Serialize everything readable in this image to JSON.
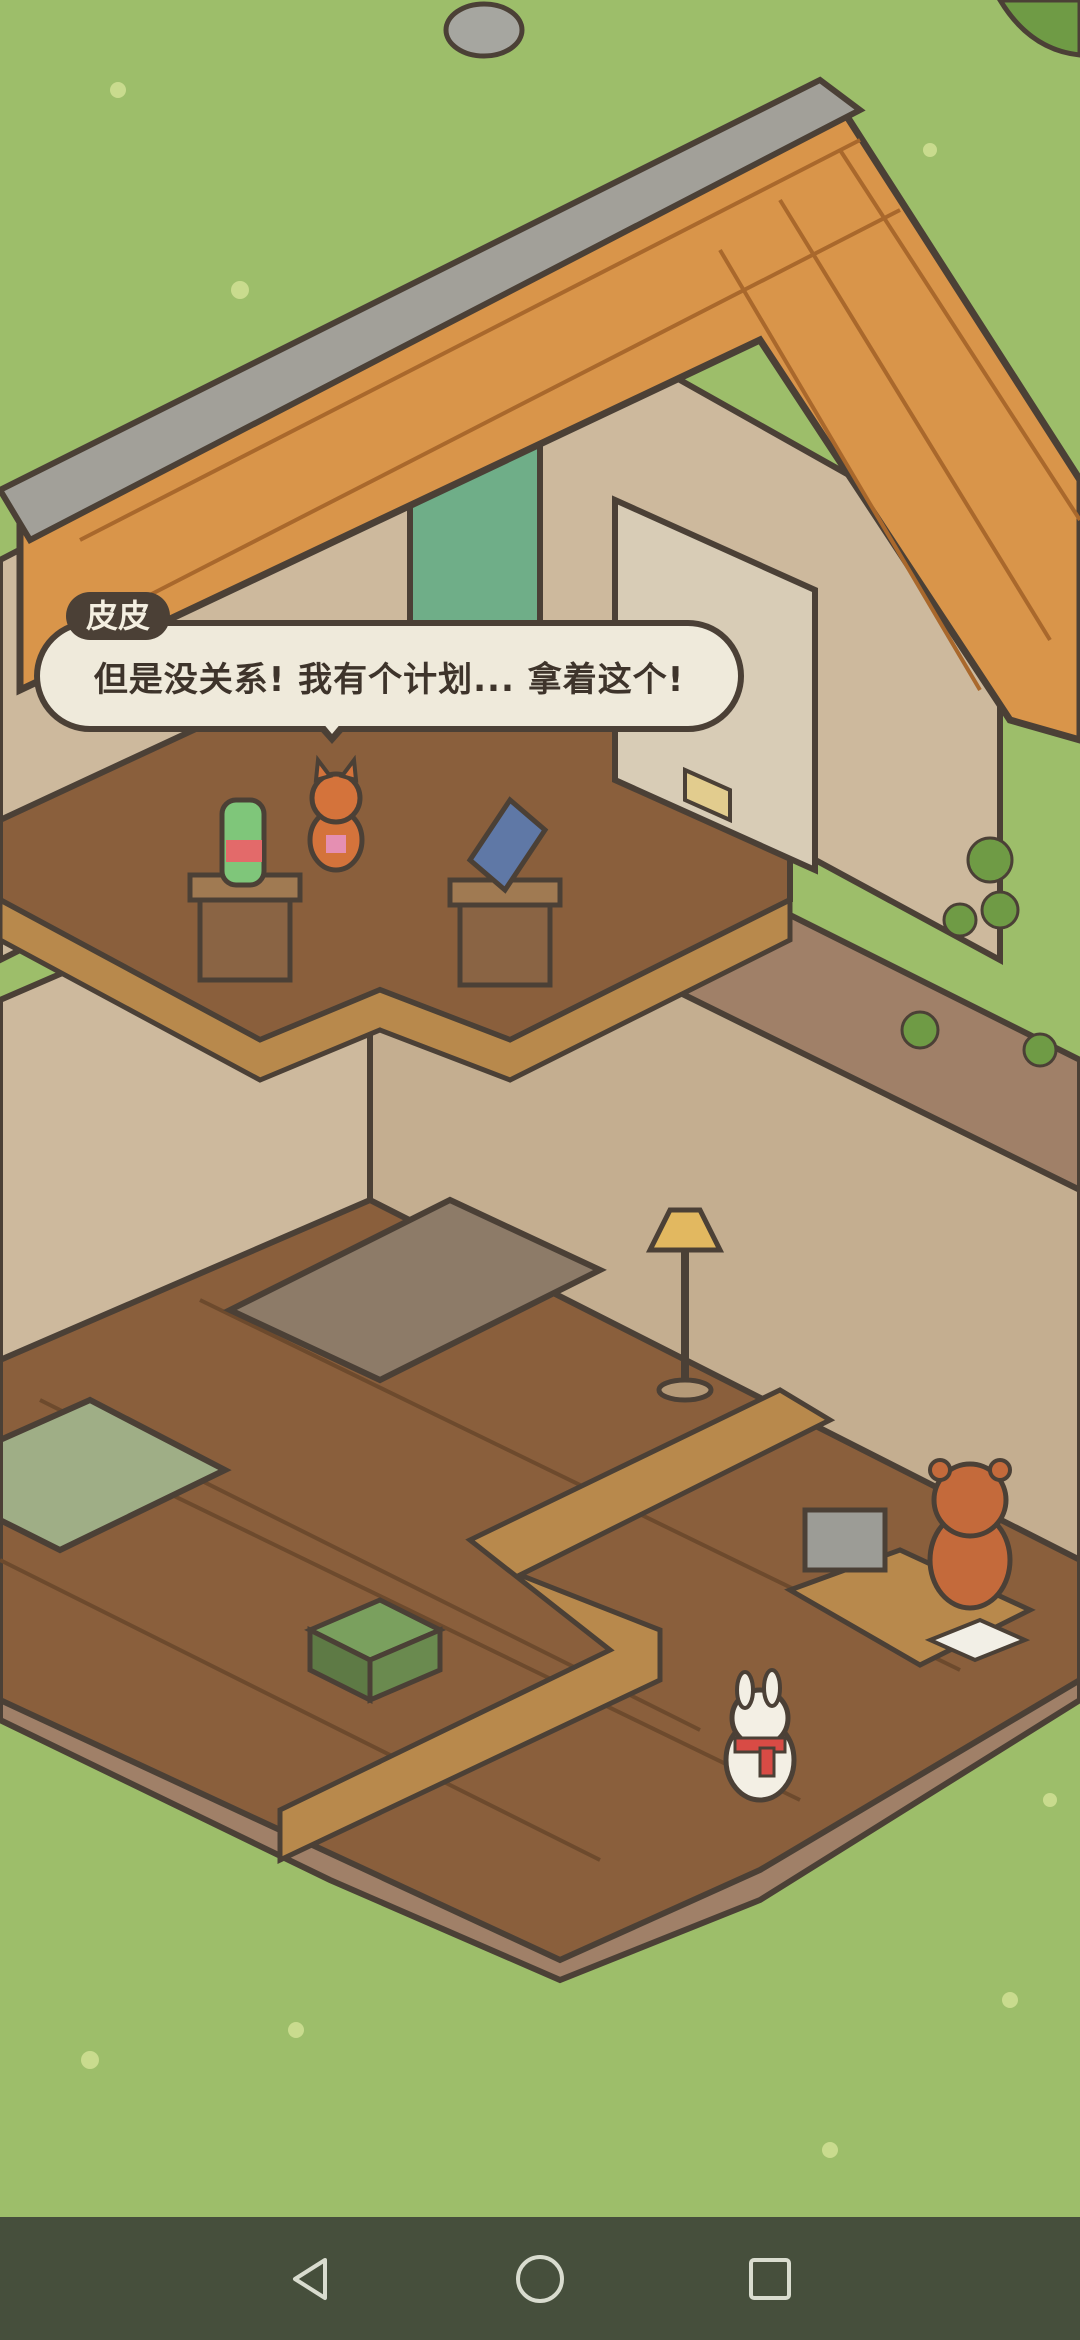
{
  "dialog": {
    "speaker": "皮皮",
    "text": "但是没关系! 我有个计划... 拿着这个!"
  },
  "scene": {
    "characters": [
      "fox-pipi",
      "red-panda-shopkeeper",
      "white-bunny-player"
    ],
    "props": [
      "ramune-bottle-pedestal",
      "notebook-pedestal",
      "floor-lamp",
      "coffee-table",
      "green-table",
      "green-stool",
      "cash-register",
      "open-book"
    ],
    "colors": {
      "grass": "#9dbe6a",
      "wall": "#cdb99d",
      "floor": "#8a5f3c",
      "roof": "#d9954a",
      "outline": "#4b4036"
    }
  },
  "navbar": {
    "back_icon": "triangle-back",
    "home_icon": "circle-home",
    "recent_icon": "square-recent"
  }
}
